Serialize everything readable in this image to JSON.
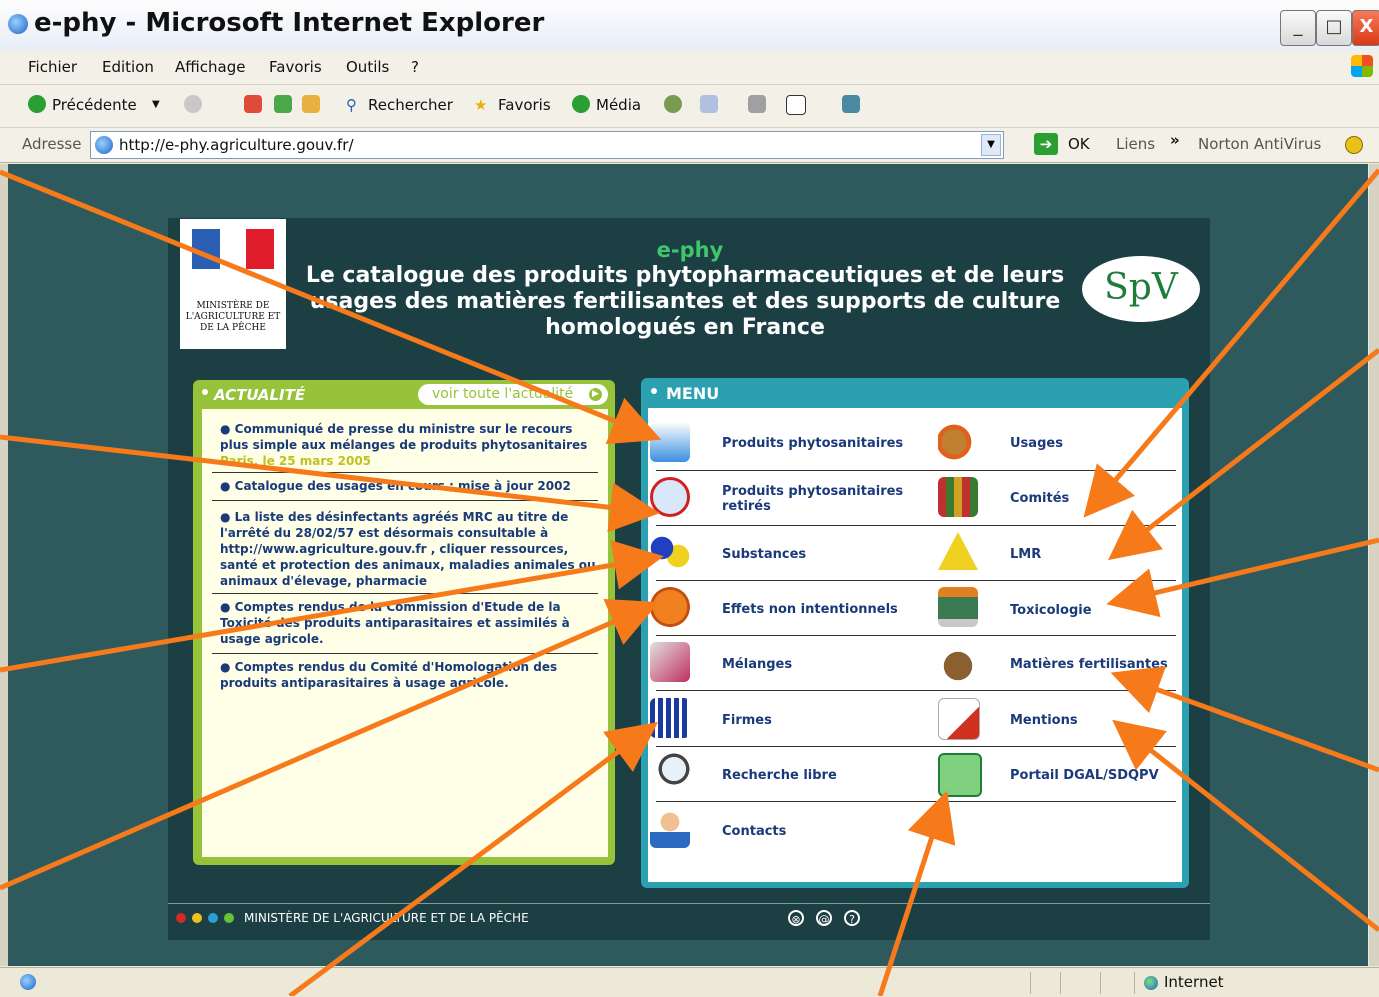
{
  "window": {
    "title": "e-phy - Microsoft Internet Explorer"
  },
  "menubar": [
    "Fichier",
    "Edition",
    "Affichage",
    "Favoris",
    "Outils",
    "?"
  ],
  "toolbar": {
    "back": "Précédente",
    "search": "Rechercher",
    "favorites": "Favoris",
    "media": "Média"
  },
  "addressbar": {
    "label": "Adresse",
    "url": "http://e-phy.agriculture.gouv.fr/",
    "go": "OK",
    "links": "Liens",
    "norton": "Norton AntiVirus"
  },
  "page": {
    "ministere": "MINISTÈRE DE L'AGRICULTURE ET DE LA PÊCHE",
    "title": "e-phy",
    "description": "Le catalogue des produits phytopharmaceutiques et de leurs usages des matières fertilisantes et des supports de culture homologués en France",
    "spv_logo": "SpV"
  },
  "news": {
    "title": "ACTUALITÉ",
    "link": "voir toute l'actualité",
    "items": [
      {
        "text": "● Communiqué de presse du ministre sur le recours plus simple aux mélanges de produits phytosanitaires",
        "date": "Paris, le 25 mars 2005"
      },
      {
        "text": "● Catalogue des usages en cours ; mise à jour 2002"
      },
      {
        "text": "● La liste des désinfectants agréés MRC au titre de l'arrêté du 28/02/57 est désormais consultable à http://www.agriculture.gouv.fr , cliquer ressources, santé et protection des animaux, maladies animales ou animaux d'élevage, pharmacie"
      },
      {
        "text": "● Comptes rendus de la Commission d'Etude de la Toxicité des produits antiparasitaires et assimilés à usage agricole."
      },
      {
        "text": "● Comptes rendus du Comité d'Homologation des produits antiparasitaires à usage agricole."
      }
    ]
  },
  "menu": {
    "title": "MENU",
    "left": [
      "Produits phytosanitaires",
      "Produits phytosanitaires retirés",
      "Substances",
      "Effets non intentionnels",
      "Mélanges",
      "Firmes",
      "Recherche libre",
      "Contacts"
    ],
    "right": [
      "Usages",
      "Comités",
      "LMR",
      "Toxicologie",
      "Matières fertilisantes",
      "Mentions",
      "Portail DGAL/SDQPV"
    ]
  },
  "footer": {
    "text": "MINISTÈRE DE L'AGRICULTURE ET DE LA PÊCHE"
  },
  "statusbar": {
    "zone": "Internet"
  },
  "colors": {
    "annotation_arrow": "#f77a1a",
    "page_bg": "#1c3f43",
    "news_green": "#96c33a",
    "menu_teal": "#2aa0b0"
  }
}
